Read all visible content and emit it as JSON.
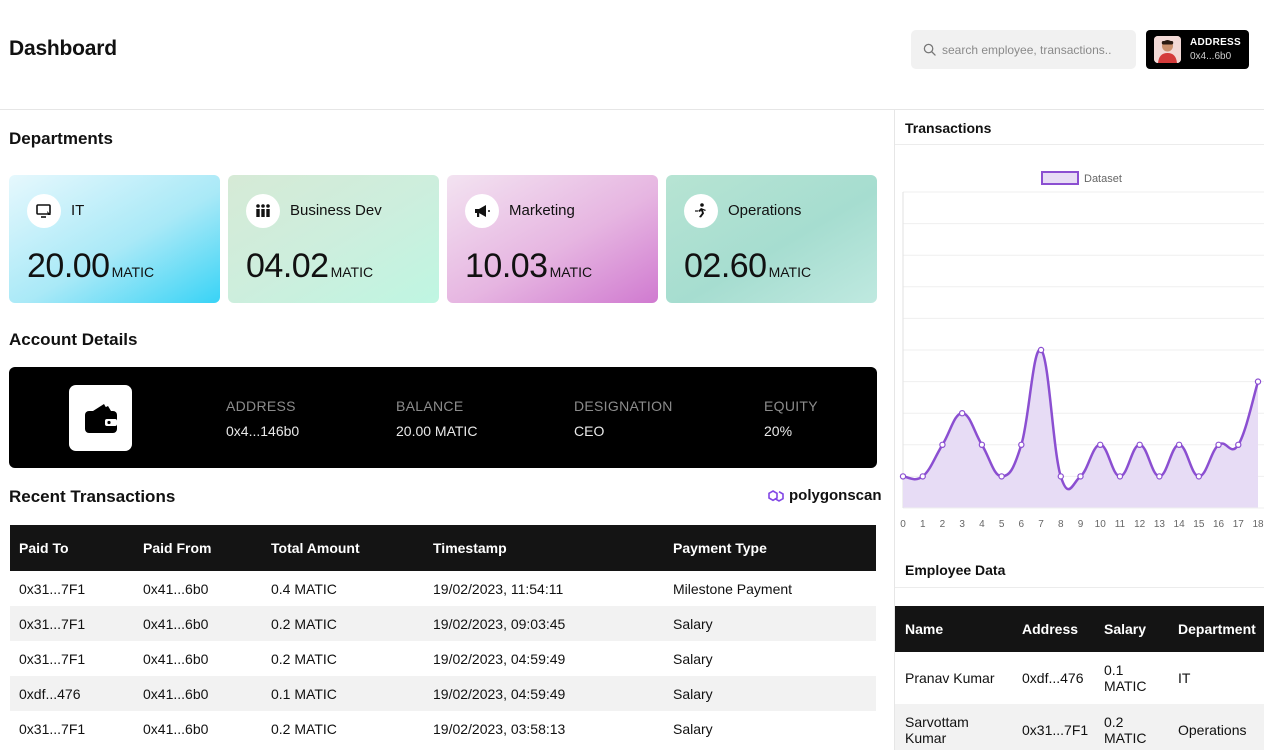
{
  "header": {
    "title": "Dashboard",
    "search_placeholder": "search employee, transactions..",
    "wallet_label": "ADDRESS",
    "wallet_address": "0x4...6b0"
  },
  "departments": {
    "title": "Departments",
    "cards": [
      {
        "name": "IT",
        "value": "20.00",
        "unit": "MATIC",
        "icon": "computer-icon"
      },
      {
        "name": "Business Dev",
        "value": "04.02",
        "unit": "MATIC",
        "icon": "team-icon"
      },
      {
        "name": "Marketing",
        "value": "10.03",
        "unit": "MATIC",
        "icon": "megaphone-icon"
      },
      {
        "name": "Operations",
        "value": "02.60",
        "unit": "MATIC",
        "icon": "runner-icon"
      }
    ]
  },
  "account": {
    "title": "Account Details",
    "address_label": "ADDRESS",
    "address": "0x4...146b0",
    "balance_label": "BALANCE",
    "balance": "20.00 MATIC",
    "designation_label": "DESIGNATION",
    "designation": "CEO",
    "equity_label": "EQUITY",
    "equity": "20%"
  },
  "recent": {
    "title": "Recent Transactions",
    "explorer_link": "polygonscan",
    "columns": [
      "Paid To",
      "Paid From",
      "Total Amount",
      "Timestamp",
      "Payment Type"
    ],
    "rows": [
      [
        "0x31...7F1",
        "0x41...6b0",
        "0.4 MATIC",
        "19/02/2023, 11:54:11",
        "Milestone Payment"
      ],
      [
        "0x31...7F1",
        "0x41...6b0",
        "0.2 MATIC",
        "19/02/2023, 09:03:45",
        "Salary"
      ],
      [
        "0x31...7F1",
        "0x41...6b0",
        "0.2 MATIC",
        "19/02/2023, 04:59:49",
        "Salary"
      ],
      [
        "0xdf...476",
        "0x41...6b0",
        "0.1 MATIC",
        "19/02/2023, 04:59:49",
        "Salary"
      ],
      [
        "0x31...7F1",
        "0x41...6b0",
        "0.2 MATIC",
        "19/02/2023, 03:58:13",
        "Salary"
      ]
    ]
  },
  "transactions_panel": {
    "title": "Transactions"
  },
  "chart_data": {
    "type": "area",
    "legend": [
      "Dataset"
    ],
    "legend_position": "top-center",
    "x": [
      0,
      1,
      2,
      3,
      4,
      5,
      6,
      7,
      8,
      9,
      10,
      11,
      12,
      13,
      14,
      15,
      16,
      17,
      18
    ],
    "series": [
      {
        "name": "Dataset",
        "values": [
          0,
          0,
          1,
          2,
          1,
          0,
          1,
          4,
          0,
          0,
          1,
          0,
          1,
          0,
          1,
          0,
          1,
          1,
          3
        ]
      }
    ],
    "ylim": [
      -1,
      9
    ],
    "grid": true,
    "colors": {
      "line": "#8b4fd1",
      "fill": "#e7dcf5"
    }
  },
  "employees": {
    "title": "Employee Data",
    "columns": [
      "Name",
      "Address",
      "Salary",
      "Department"
    ],
    "rows": [
      [
        "Pranav Kumar",
        "0xdf...476",
        "0.1 MATIC",
        "IT"
      ],
      [
        "Sarvottam Kumar",
        "0x31...7F1",
        "0.2 MATIC",
        "Operations"
      ]
    ]
  }
}
